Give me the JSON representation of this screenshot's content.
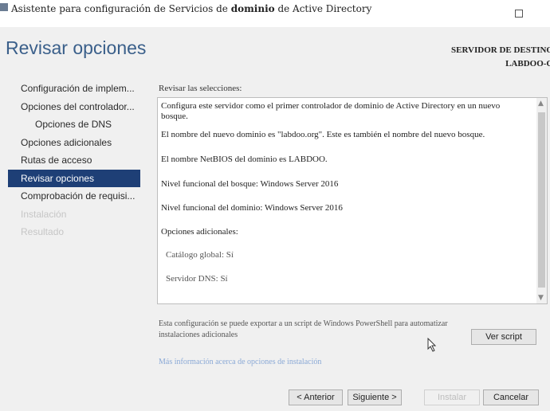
{
  "window": {
    "title_parts": [
      "Asistente para configuración de Servicios de ",
      "dominio",
      " de Active Directory"
    ]
  },
  "header": {
    "page_title": "Revisar opciones",
    "server_label_line1": "SERVIDOR DE DESTINO",
    "server_label_line2": "LABDOO-G"
  },
  "sidebar": {
    "items": [
      {
        "label": "Configuración de implem..."
      },
      {
        "label": "Opciones del controlador..."
      },
      {
        "label": "Opciones de DNS"
      },
      {
        "label": "Opciones adicionales"
      },
      {
        "label": "Rutas de acceso"
      },
      {
        "label": "Revisar opciones"
      },
      {
        "label": "Comprobación de requisi..."
      },
      {
        "label": "Instalación"
      },
      {
        "label": "Resultado"
      }
    ]
  },
  "main": {
    "section_label": "Revisar las selecciones:",
    "review_lines": [
      "Configura este servidor como el primer controlador de dominio de Active Directory en un nuevo bosque.",
      "El nombre del nuevo dominio es \"labdoo.org\". Este es también el nombre del nuevo bosque.",
      "El nombre NetBIOS del dominio es LABDOO.",
      "Nivel funcional del bosque: Windows Server 2016",
      "Nivel funcional del dominio: Windows Server 2016",
      "Opciones adicionales:",
      "Catálogo global: Sí",
      "Servidor DNS: Sí"
    ],
    "export_text": "Esta configuración se puede exportar a un script de Windows PowerShell para automatizar instalaciones adicionales",
    "view_script_label": "Ver script",
    "more_info_link": "Más información acerca de opciones de instalación"
  },
  "footer": {
    "back_label": "< Anterior",
    "next_label": "Siguiente >",
    "install_label": "Instalar",
    "cancel_label": "Cancelar"
  },
  "colors": {
    "title_blue": "#3a5f8a",
    "active_nav": "#1e3f76",
    "link": "#8aa9d6"
  },
  "icons": {
    "app": "app-icon",
    "maximize": "maximize-icon",
    "scroll_up": "chevron-up-icon",
    "scroll_down": "chevron-down-icon",
    "cursor": "mouse-cursor-icon"
  }
}
